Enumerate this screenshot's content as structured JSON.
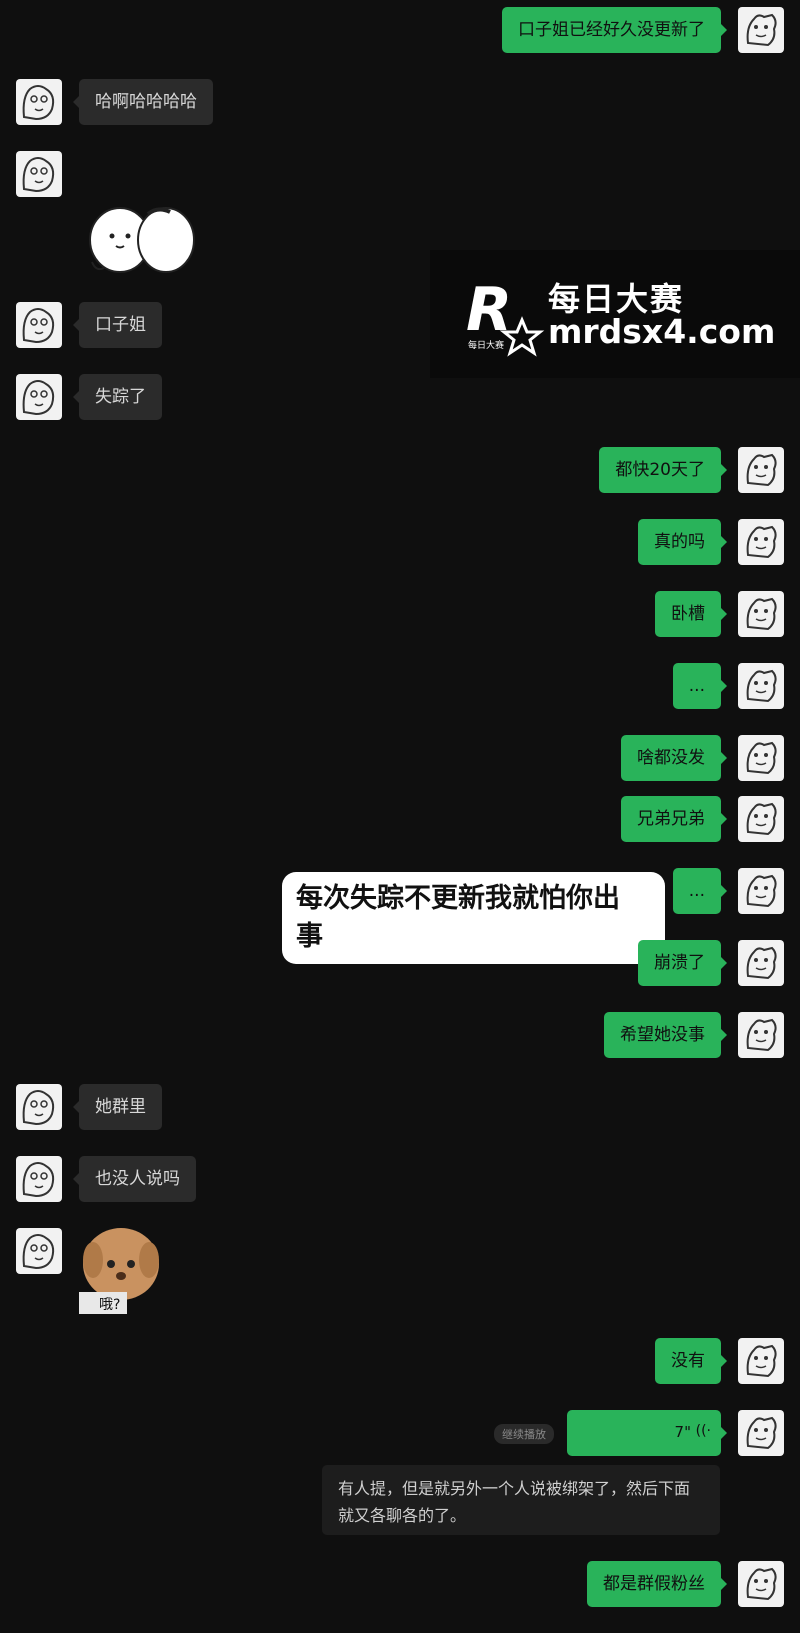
{
  "messages": [
    {
      "side": "right",
      "text": "口子姐已经好久没更新了"
    },
    {
      "side": "left",
      "text": "哈啊哈哈哈哈"
    },
    {
      "side": "left",
      "text": "口子姐"
    },
    {
      "side": "left",
      "text": "失踪了"
    },
    {
      "side": "right",
      "text": "都快20天了"
    },
    {
      "side": "right",
      "text": "真的吗"
    },
    {
      "side": "right",
      "text": "卧槽"
    },
    {
      "side": "right",
      "text": "..."
    },
    {
      "side": "right",
      "text": "啥都没发"
    },
    {
      "side": "right",
      "text": "兄弟兄弟"
    },
    {
      "side": "right",
      "text": "..."
    },
    {
      "side": "right",
      "text": "崩溃了"
    },
    {
      "side": "right",
      "text": "希望她没事"
    },
    {
      "side": "left",
      "text": "她群里"
    },
    {
      "side": "left",
      "text": "也没人说吗"
    },
    {
      "side": "right",
      "text": "没有"
    },
    {
      "side": "right",
      "text": "都是群假粉丝"
    }
  ],
  "sticker_dog": {
    "caption": "哦?"
  },
  "watermark": {
    "letter": "R",
    "small": "每日大赛",
    "cn": "每日大赛",
    "url": "mrdsx4.com"
  },
  "popup": {
    "text": "每次失踪不更新我就怕你出\n事"
  },
  "voice": {
    "duration": "7\"",
    "hint": "继续播放"
  },
  "transcript": {
    "text": "有人提，但是就另外一个人说被绑架了，然后下面就又各聊各的了。"
  },
  "colors": {
    "bg": "#0f0f0f",
    "me_bubble": "#29b35a",
    "them_bubble": "#2b2b2b"
  }
}
